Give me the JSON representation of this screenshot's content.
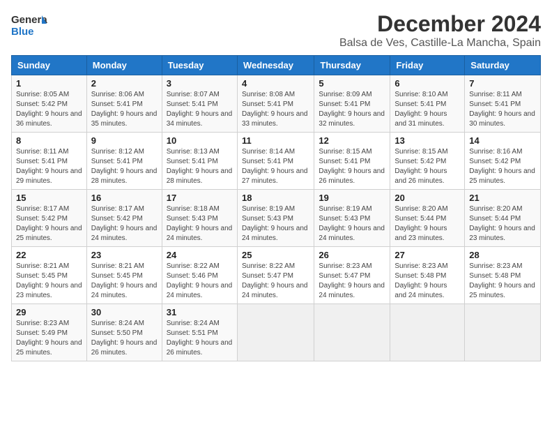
{
  "logo": {
    "line1": "General",
    "line2": "Blue"
  },
  "title": "December 2024",
  "subtitle": "Balsa de Ves, Castille-La Mancha, Spain",
  "header": {
    "accent_color": "#2176c7"
  },
  "days_of_week": [
    "Sunday",
    "Monday",
    "Tuesday",
    "Wednesday",
    "Thursday",
    "Friday",
    "Saturday"
  ],
  "weeks": [
    [
      {
        "day": "1",
        "sunrise": "8:05 AM",
        "sunset": "5:42 PM",
        "daylight": "9 hours and 36 minutes."
      },
      {
        "day": "2",
        "sunrise": "8:06 AM",
        "sunset": "5:41 PM",
        "daylight": "9 hours and 35 minutes."
      },
      {
        "day": "3",
        "sunrise": "8:07 AM",
        "sunset": "5:41 PM",
        "daylight": "9 hours and 34 minutes."
      },
      {
        "day": "4",
        "sunrise": "8:08 AM",
        "sunset": "5:41 PM",
        "daylight": "9 hours and 33 minutes."
      },
      {
        "day": "5",
        "sunrise": "8:09 AM",
        "sunset": "5:41 PM",
        "daylight": "9 hours and 32 minutes."
      },
      {
        "day": "6",
        "sunrise": "8:10 AM",
        "sunset": "5:41 PM",
        "daylight": "9 hours and 31 minutes."
      },
      {
        "day": "7",
        "sunrise": "8:11 AM",
        "sunset": "5:41 PM",
        "daylight": "9 hours and 30 minutes."
      }
    ],
    [
      {
        "day": "8",
        "sunrise": "8:11 AM",
        "sunset": "5:41 PM",
        "daylight": "9 hours and 29 minutes."
      },
      {
        "day": "9",
        "sunrise": "8:12 AM",
        "sunset": "5:41 PM",
        "daylight": "9 hours and 28 minutes."
      },
      {
        "day": "10",
        "sunrise": "8:13 AM",
        "sunset": "5:41 PM",
        "daylight": "9 hours and 28 minutes."
      },
      {
        "day": "11",
        "sunrise": "8:14 AM",
        "sunset": "5:41 PM",
        "daylight": "9 hours and 27 minutes."
      },
      {
        "day": "12",
        "sunrise": "8:15 AM",
        "sunset": "5:41 PM",
        "daylight": "9 hours and 26 minutes."
      },
      {
        "day": "13",
        "sunrise": "8:15 AM",
        "sunset": "5:42 PM",
        "daylight": "9 hours and 26 minutes."
      },
      {
        "day": "14",
        "sunrise": "8:16 AM",
        "sunset": "5:42 PM",
        "daylight": "9 hours and 25 minutes."
      }
    ],
    [
      {
        "day": "15",
        "sunrise": "8:17 AM",
        "sunset": "5:42 PM",
        "daylight": "9 hours and 25 minutes."
      },
      {
        "day": "16",
        "sunrise": "8:17 AM",
        "sunset": "5:42 PM",
        "daylight": "9 hours and 24 minutes."
      },
      {
        "day": "17",
        "sunrise": "8:18 AM",
        "sunset": "5:43 PM",
        "daylight": "9 hours and 24 minutes."
      },
      {
        "day": "18",
        "sunrise": "8:19 AM",
        "sunset": "5:43 PM",
        "daylight": "9 hours and 24 minutes."
      },
      {
        "day": "19",
        "sunrise": "8:19 AM",
        "sunset": "5:43 PM",
        "daylight": "9 hours and 24 minutes."
      },
      {
        "day": "20",
        "sunrise": "8:20 AM",
        "sunset": "5:44 PM",
        "daylight": "9 hours and 23 minutes."
      },
      {
        "day": "21",
        "sunrise": "8:20 AM",
        "sunset": "5:44 PM",
        "daylight": "9 hours and 23 minutes."
      }
    ],
    [
      {
        "day": "22",
        "sunrise": "8:21 AM",
        "sunset": "5:45 PM",
        "daylight": "9 hours and 23 minutes."
      },
      {
        "day": "23",
        "sunrise": "8:21 AM",
        "sunset": "5:45 PM",
        "daylight": "9 hours and 24 minutes."
      },
      {
        "day": "24",
        "sunrise": "8:22 AM",
        "sunset": "5:46 PM",
        "daylight": "9 hours and 24 minutes."
      },
      {
        "day": "25",
        "sunrise": "8:22 AM",
        "sunset": "5:47 PM",
        "daylight": "9 hours and 24 minutes."
      },
      {
        "day": "26",
        "sunrise": "8:23 AM",
        "sunset": "5:47 PM",
        "daylight": "9 hours and 24 minutes."
      },
      {
        "day": "27",
        "sunrise": "8:23 AM",
        "sunset": "5:48 PM",
        "daylight": "9 hours and 24 minutes."
      },
      {
        "day": "28",
        "sunrise": "8:23 AM",
        "sunset": "5:48 PM",
        "daylight": "9 hours and 25 minutes."
      }
    ],
    [
      {
        "day": "29",
        "sunrise": "8:23 AM",
        "sunset": "5:49 PM",
        "daylight": "9 hours and 25 minutes."
      },
      {
        "day": "30",
        "sunrise": "8:24 AM",
        "sunset": "5:50 PM",
        "daylight": "9 hours and 26 minutes."
      },
      {
        "day": "31",
        "sunrise": "8:24 AM",
        "sunset": "5:51 PM",
        "daylight": "9 hours and 26 minutes."
      },
      null,
      null,
      null,
      null
    ]
  ],
  "labels": {
    "sunrise": "Sunrise:",
    "sunset": "Sunset:",
    "daylight": "Daylight:"
  }
}
